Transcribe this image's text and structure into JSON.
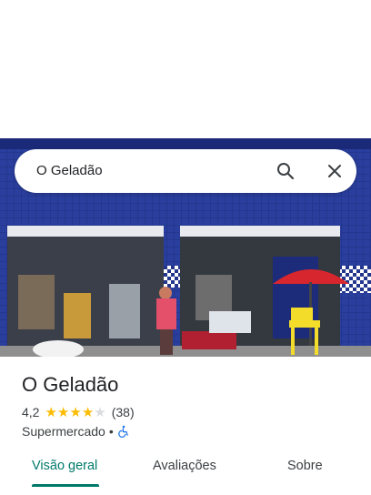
{
  "search": {
    "query": "O Geladão"
  },
  "place": {
    "name": "O Geladão",
    "rating": "4,2",
    "stars": 4,
    "reviews": "(38)",
    "category": "Supermercado",
    "separator": "•"
  },
  "tabs": [
    {
      "label": "Visão geral",
      "active": true
    },
    {
      "label": "Avaliações",
      "active": false
    },
    {
      "label": "Sobre",
      "active": false
    }
  ],
  "colors": {
    "accent": "#00796b",
    "star": "#fbbc04",
    "accessibility": "#1a73e8"
  },
  "icons": {
    "search": "search-icon",
    "close": "close-icon",
    "accessibility": "wheelchair-icon"
  }
}
